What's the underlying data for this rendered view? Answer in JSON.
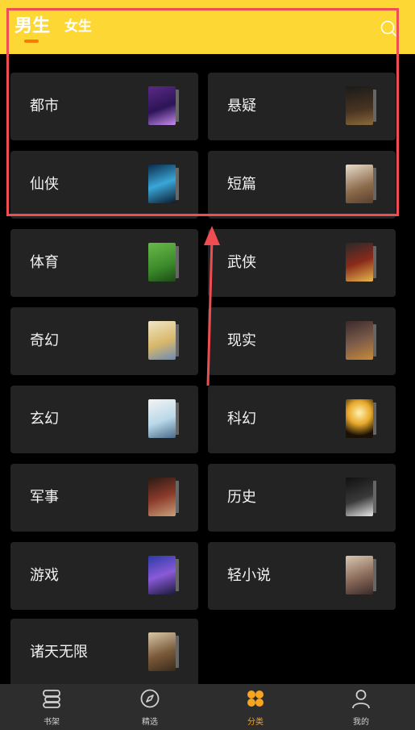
{
  "header": {
    "tabs": [
      {
        "label": "男生",
        "active": true
      },
      {
        "label": "女生",
        "active": false
      }
    ],
    "search_icon": "search-icon",
    "accent": "#fdd835"
  },
  "categories": [
    {
      "label": "都市",
      "cover": "book-cover"
    },
    {
      "label": "悬疑",
      "cover": "book-cover"
    },
    {
      "label": "仙侠",
      "cover": "book-cover"
    },
    {
      "label": "短篇",
      "cover": "book-cover"
    },
    {
      "label": "体育",
      "cover": "book-cover"
    },
    {
      "label": "武侠",
      "cover": "book-cover"
    },
    {
      "label": "奇幻",
      "cover": "book-cover"
    },
    {
      "label": "现实",
      "cover": "book-cover"
    },
    {
      "label": "玄幻",
      "cover": "book-cover"
    },
    {
      "label": "科幻",
      "cover": "book-cover"
    },
    {
      "label": "军事",
      "cover": "book-cover"
    },
    {
      "label": "历史",
      "cover": "book-cover"
    },
    {
      "label": "游戏",
      "cover": "book-cover"
    },
    {
      "label": "轻小说",
      "cover": "book-cover"
    },
    {
      "label": "诸天无限",
      "cover": "book-cover"
    }
  ],
  "bottom_nav": [
    {
      "label": "书架",
      "icon": "bookshelf-icon",
      "active": false
    },
    {
      "label": "精选",
      "icon": "compass-icon",
      "active": false
    },
    {
      "label": "分类",
      "icon": "category-icon",
      "active": true
    },
    {
      "label": "我的",
      "icon": "profile-icon",
      "active": false
    }
  ],
  "colors": {
    "highlight": "#ef4d52",
    "nav_active": "#f6a421"
  }
}
